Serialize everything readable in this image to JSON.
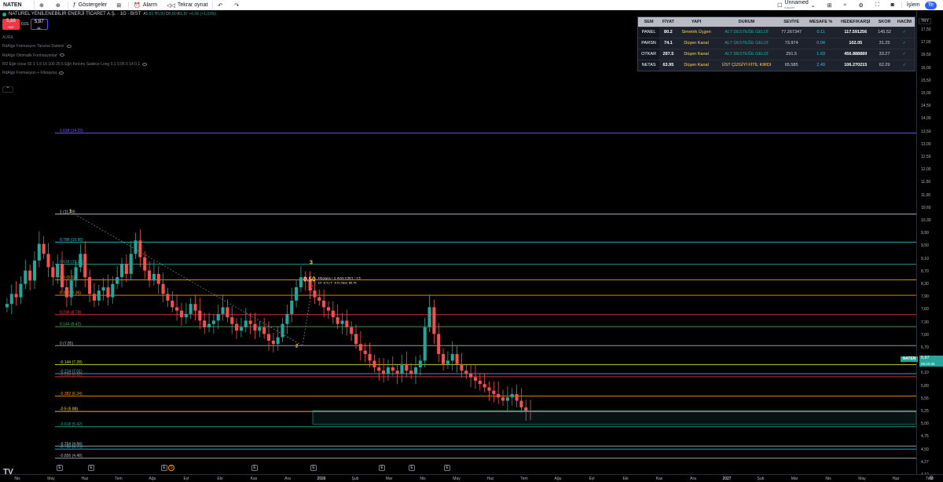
{
  "toolbar": {
    "symbol": "NATEN",
    "indicators_label": "Göstergeler",
    "alarm_label": "Alarm",
    "replay_label": "Tekrar oynat",
    "layout_name": "Unnamed",
    "layout_status": "Kaydet",
    "trade_label": "İşlem",
    "trade_badge": "Te"
  },
  "legend": {
    "title": "NATUREL YENİLENEBİLİR ENERJİ TİCARET A.Ş. · 1G · BIST",
    "ohlc": [
      {
        "label": "A",
        "value": "5,81"
      },
      {
        "label": "Y",
        "value": "5,90"
      },
      {
        "label": "D",
        "value": "5,80"
      },
      {
        "label": "K",
        "value": "5,87"
      }
    ],
    "change": "+0,06 (+1,03%)",
    "sell_price": "5,86",
    "sell_label": "SAT",
    "spread": "0,01",
    "buy_price": "5,87",
    "buy_label": "AL",
    "indicators": [
      "AURA",
      "RdAlgo Formasyon Tarama Sistemi",
      "RdAlgo Otomatik Formasyonlar",
      "RD Eğri close 55 1 1,5 15 100 25 6 Eğri Kırılımı Sadece Long 0,1 0,05 0 14 0,1",
      "RdAlgo Formasyon + Fiboayna"
    ]
  },
  "screener": {
    "headers": [
      "SEM",
      "FİYAT",
      "YAPI",
      "DURUM",
      "SEVİYE",
      "MESAFE %",
      "HEDEF/KARŞI",
      "SKOR",
      "HACİM"
    ],
    "rows": [
      {
        "sym": "PANEL",
        "price": "80.2",
        "pattern": "Simetrik Üçgen",
        "status": "ALT DESTEĞE GELDİ",
        "level": "77.267347",
        "dist": "0.11",
        "target": "117.591256",
        "score": "145.52",
        "vol": "✓"
      },
      {
        "sym": "PARSN",
        "price": "74.1",
        "pattern": "Düşen Kanal",
        "status": "ALT DESTEĞE GELDİ",
        "level": "73.974",
        "dist": "0.04",
        "target": "102.05",
        "score": "31.25",
        "vol": "✓"
      },
      {
        "sym": "OTKAR",
        "price": "297.5",
        "pattern": "Düşen Kanal",
        "status": "ALT DESTEĞE GELDİ",
        "level": "291.5",
        "dist": "1.03",
        "target": "456.888889",
        "score": "33.27",
        "vol": "✓"
      },
      {
        "sym": "NETAS",
        "price": "63.95",
        "pattern": "Düşen Kanal",
        "status": "ÜST ÇİZGİYİ FİTİL KIRDI",
        "level": "65.585",
        "dist": "2.49",
        "target": "106.270215",
        "score": "62.29",
        "vol": "✓"
      }
    ]
  },
  "price_axis": {
    "currency": "TRY",
    "ticks": [
      "17,50",
      "17,00",
      "16,50",
      "16,00",
      "15,50",
      "15,00",
      "14,50",
      "14,00",
      "13,50",
      "13,00",
      "12,50",
      "12,00",
      "11,50",
      "11,00",
      "10,60",
      "10,30",
      "9,90",
      "9,50",
      "9,10",
      "8,70",
      "8,30",
      "7,90",
      "7,60",
      "7,30",
      "7,00",
      "6,70",
      "6,40",
      "6,10",
      "5,80",
      "5,55",
      "5,25",
      "5,00",
      "4,75",
      "4,50",
      "4,27",
      "4,12"
    ]
  },
  "time_axis": {
    "ticks": [
      "Nis",
      "May",
      "Haz",
      "Tem",
      "Ağu",
      "Eyl",
      "Eki",
      "Kas",
      "Ara",
      "2026",
      "Şub",
      "Mar",
      "Nis",
      "May",
      "Haz",
      "Tem",
      "Ağu",
      "Eyl",
      "Eki",
      "Kas",
      "Ara",
      "2027",
      "Şub",
      "Mar",
      "Nis",
      "May",
      "Haz",
      "Tem"
    ]
  },
  "fib_levels": [
    {
      "label": "1.618 (14.22)",
      "value": 14.22,
      "color": "#7b61ff"
    },
    {
      "label": "1 (11.79)",
      "value": 11.79,
      "color": "#d1d4dc"
    },
    {
      "label": "0.786 (10.95)",
      "value": 10.95,
      "color": "#26c6da"
    },
    {
      "label": "0.618 (10.29)",
      "value": 10.29,
      "color": "#26a69a"
    },
    {
      "label": "0.5 (9.82)",
      "value": 9.82,
      "color": "#ff9800"
    },
    {
      "label": "0.382 (9.36)",
      "value": 9.36,
      "color": "#ff9800"
    },
    {
      "label": "0.236 (8.78)",
      "value": 8.78,
      "color": "#f23645"
    },
    {
      "label": "0.144 (8.42)",
      "value": 8.42,
      "color": "#4caf50"
    },
    {
      "label": "0 (7.85)",
      "value": 7.85,
      "color": "#b2b5be"
    },
    {
      "label": "-0.144 (7.28)",
      "value": 7.28,
      "color": "#cddc39"
    },
    {
      "label": "-0.214 (7.01)",
      "value": 7.01,
      "color": "#26c6da"
    },
    {
      "label": "-0.236 (6.92)",
      "value": 6.92,
      "color": "#f23645"
    },
    {
      "label": "-0.382 (6.34)",
      "value": 6.34,
      "color": "#ff9800"
    },
    {
      "label": "-0.5 (5.88)",
      "value": 5.88,
      "color": "#ffd54f"
    },
    {
      "label": "-0.618 (5.42)",
      "value": 5.42,
      "color": "#26a69a"
    },
    {
      "label": "-0.764 (4.84)",
      "value": 4.84,
      "color": "#b2b5be"
    },
    {
      "label": "-0.786 (4.75)",
      "value": 4.75,
      "color": "#26c6da"
    },
    {
      "label": "-0.856 (4.48)",
      "value": 4.48,
      "color": "#b2b5be"
    }
  ],
  "chart_labels": {
    "wave_1": "1",
    "wave_2": "2",
    "wave_3": "3",
    "fib_mid": "0.50",
    "annotation_line1": "Fiboayna + 3. Adım 0.50/1 ↑ 0.5",
    "annotation_line2": "Dt: -0.5 | T: -0.5 | Skor: 85.76"
  },
  "current_price": {
    "symbol": "NATEN",
    "price": "5,87",
    "countdown": "05:20:36"
  },
  "logo": "TV",
  "events": [
    "E",
    "E",
    "E",
    "E",
    "E",
    "E",
    "E",
    "E"
  ],
  "dividend_marker": "S",
  "chart_data": {
    "type": "candlestick",
    "series_close": [
      9.1,
      9.4,
      9.3,
      9.7,
      10.1,
      9.8,
      10.4,
      10.9,
      10.6,
      10.2,
      9.9,
      10.3,
      9.6,
      9.3,
      9.8,
      10.2,
      10.6,
      9.9,
      9.4,
      9.2,
      9.5,
      9.6,
      9.3,
      9.7,
      9.9,
      10.3,
      10.0,
      10.6,
      11.0,
      10.5,
      10.1,
      9.8,
      10.0,
      9.7,
      9.4,
      9.2,
      9.0,
      8.9,
      8.7,
      8.8,
      9.1,
      8.9,
      8.6,
      8.4,
      8.5,
      8.6,
      8.8,
      9.0,
      8.7,
      8.5,
      8.3,
      8.4,
      8.6,
      8.5,
      8.3,
      8.4,
      8.2,
      8.0,
      7.9,
      8.1,
      8.5,
      8.8,
      9.2,
      9.6,
      9.9,
      9.8,
      9.5,
      9.3,
      9.2,
      9.0,
      8.9,
      8.7,
      8.5,
      8.6,
      8.4,
      8.2,
      7.9,
      7.7,
      7.6,
      7.4,
      7.2,
      7.1,
      7.0,
      7.2,
      7.1,
      7.0,
      7.3,
      7.1,
      7.0,
      7.2,
      7.4,
      8.4,
      9.0,
      8.2,
      7.6,
      7.3,
      7.4,
      7.6,
      7.3,
      7.1,
      7.0,
      6.9,
      6.8,
      6.7,
      6.6,
      6.5,
      6.4,
      6.3,
      6.2,
      6.3,
      6.4,
      6.2,
      6.0,
      5.9,
      5.87
    ]
  }
}
